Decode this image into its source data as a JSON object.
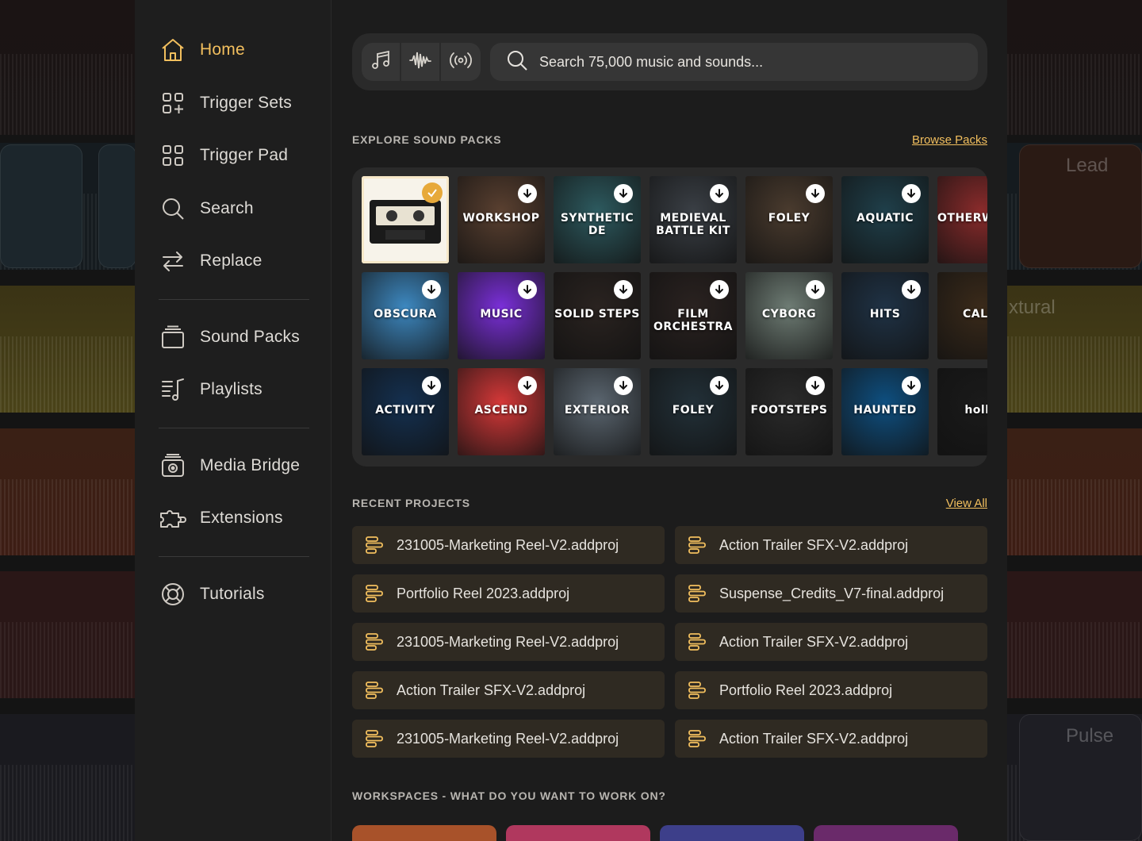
{
  "colors": {
    "accent": "#f2bf5e",
    "sidebar_bg": "#1e1e1e",
    "main_bg": "#1c1c1c",
    "project_bg": "#2f2a22"
  },
  "background": {
    "labels": [
      "Lead",
      "xtural",
      "Pulse"
    ]
  },
  "sidebar": {
    "items": [
      {
        "label": "Home",
        "icon": "home-icon",
        "active": true
      },
      {
        "label": "Trigger Sets",
        "icon": "grid-plus-icon"
      },
      {
        "label": "Trigger Pad",
        "icon": "grid-icon"
      },
      {
        "label": "Search",
        "icon": "search-icon"
      },
      {
        "label": "Replace",
        "icon": "swap-icon"
      },
      {
        "label": "Sound Packs",
        "icon": "stack-icon"
      },
      {
        "label": "Playlists",
        "icon": "playlist-icon"
      },
      {
        "label": "Media Bridge",
        "icon": "media-bridge-icon"
      },
      {
        "label": "Extensions",
        "icon": "puzzle-icon"
      },
      {
        "label": "Tutorials",
        "icon": "lifebuoy-icon"
      }
    ]
  },
  "search": {
    "placeholder": "Search 75,000 music and sounds...",
    "modes": [
      "music-note-icon",
      "waveform-icon",
      "broadcast-icon"
    ]
  },
  "sound_packs": {
    "title": "EXPLORE SOUND PACKS",
    "link": "Browse Packs",
    "packs": [
      {
        "title": "",
        "bg": "#f7f3ea",
        "selected": true
      },
      {
        "title": "WORKSHOP",
        "bg": "#5a4030"
      },
      {
        "title": "SYNTHETIC DE",
        "bg": "#2d5a5f"
      },
      {
        "title": "MEDIEVAL BATTLE KIT",
        "bg": "#3a3f45"
      },
      {
        "title": "FOLEY",
        "bg": "#4a3b2e"
      },
      {
        "title": "AQUATIC",
        "bg": "#1f3f4a"
      },
      {
        "title": "OTHERWORLD",
        "bg": "#8a2b2b"
      },
      {
        "title": "OBSCURA",
        "bg": "#3d88c0"
      },
      {
        "title": "MUSIC",
        "bg": "#7a2fd8"
      },
      {
        "title": "SOLID STEPS",
        "bg": "#2a2320"
      },
      {
        "title": "FILM ORCHESTRA",
        "bg": "#2a2220"
      },
      {
        "title": "CYBORG",
        "bg": "#6e7c74"
      },
      {
        "title": "HITS",
        "bg": "#1f3245"
      },
      {
        "title": "CALM",
        "bg": "#3a2a1a"
      },
      {
        "title": "ACTIVITY",
        "bg": "#143050"
      },
      {
        "title": "ASCEND",
        "bg": "#d53838"
      },
      {
        "title": "EXTERIOR",
        "bg": "#5b6670"
      },
      {
        "title": "FOLEY",
        "bg": "#223038"
      },
      {
        "title": "FOOTSTEPS",
        "bg": "#2a2a2a"
      },
      {
        "title": "HAUNTED",
        "bg": "#0e4f80"
      },
      {
        "title": "hollo",
        "bg": "#1a1a1a"
      }
    ]
  },
  "recent_projects": {
    "title": "RECENT PROJECTS",
    "link": "View All",
    "items": [
      "231005-Marketing Reel-V2.addproj",
      "Action Trailer SFX-V2.addproj",
      "Portfolio Reel 2023.addproj",
      "Suspense_Credits_V7-final.addproj",
      "231005-Marketing Reel-V2.addproj",
      "Action Trailer SFX-V2.addproj",
      "Action Trailer SFX-V2.addproj",
      "Portfolio Reel 2023.addproj",
      "231005-Marketing Reel-V2.addproj",
      "Action Trailer SFX-V2.addproj"
    ]
  },
  "workspaces": {
    "title": "WORKSPACES - WHAT DO YOU WANT TO WORK ON?",
    "colors": [
      "#a8522a",
      "#b0385e",
      "#3d3f8a",
      "#6a2a6a"
    ]
  }
}
